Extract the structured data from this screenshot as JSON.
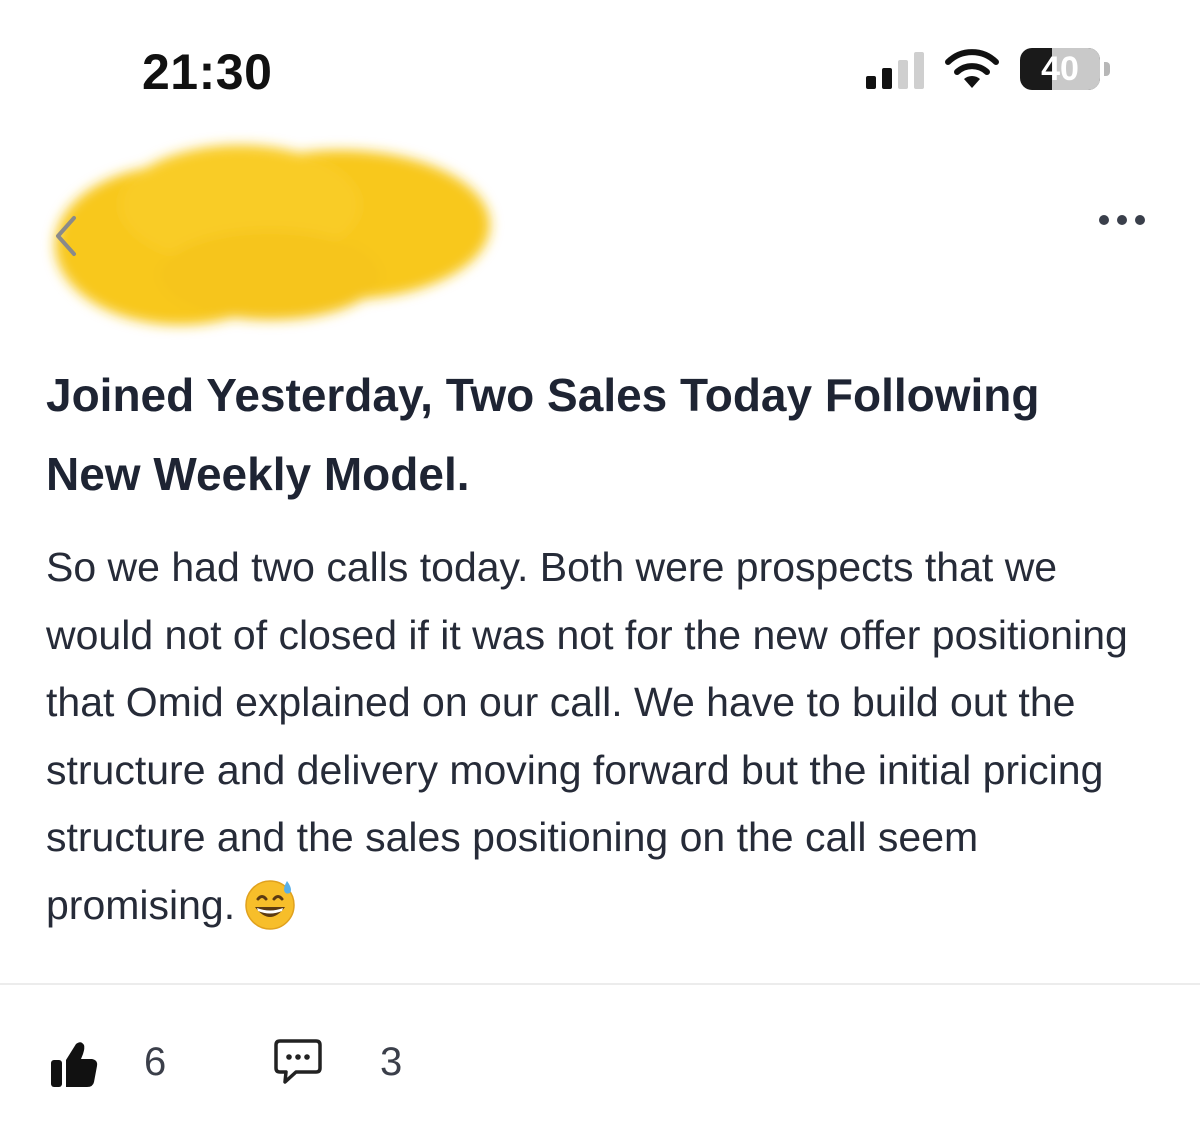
{
  "status_bar": {
    "time": "21:30",
    "battery_level": "40",
    "battery_fraction": 0.4,
    "signal_bars_active": 2,
    "signal_bars_total": 4
  },
  "nav": {
    "back_icon": "chevron-left-icon",
    "more_icon": "more-horizontal-icon",
    "redaction_color": "#f8c81c"
  },
  "post": {
    "title": "Joined Yesterday, Two Sales Today Following New Weekly Model.",
    "body": "So we had two calls today. Both were prospects that we would not of closed if it was not for the new offer positioning that Omid explained on our call. We have to build out the structure and delivery moving forward but the initial pricing structure and the sales positioning on the call seem promising.",
    "emoji": "grinning-face-with-sweat-icon"
  },
  "actions": {
    "likes": "6",
    "comments": "3",
    "like_icon": "thumbs-up-icon",
    "comment_icon": "comment-bubble-icon"
  },
  "colors": {
    "text": "#1e2433",
    "divider": "#ececec",
    "redaction": "#f8c81c"
  }
}
